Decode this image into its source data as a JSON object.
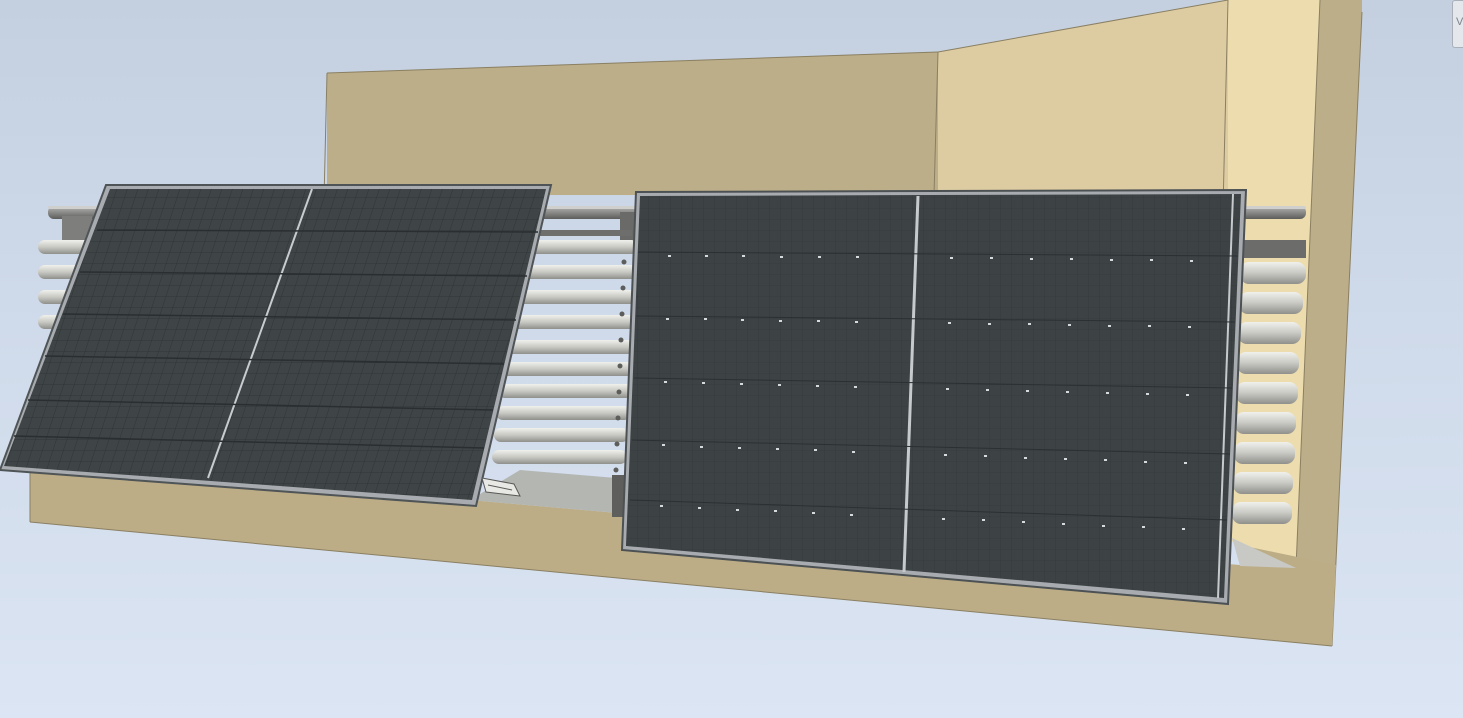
{
  "viewport": {
    "name": "3D model view",
    "background_top": "#c4d0e0",
    "background_bottom": "#dbe5f3"
  },
  "model": {
    "parts": [
      "balcony-back-wall",
      "balcony-side-wall",
      "balcony-floor",
      "top-handrail",
      "horizontal-rails",
      "left-solar-panel",
      "right-solar-panel",
      "mounting-bracket"
    ],
    "colors": {
      "wall_tan": "#bcae88",
      "wall_light": "#dccca2",
      "wall_pale": "#ecdcae",
      "rail_light": "#d4d4d0",
      "rail_dark": "#7a7a78",
      "panel_cell": "#3e4446",
      "panel_frame": "#a8acb0"
    }
  },
  "viewcube": {
    "icon": "viewcube-icon",
    "glyph": "V"
  }
}
